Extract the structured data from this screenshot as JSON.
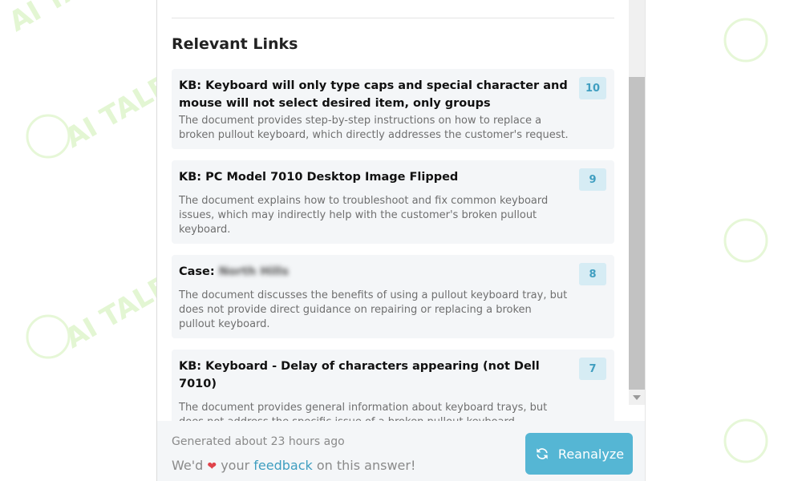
{
  "section": {
    "title": "Relevant Links"
  },
  "links": [
    {
      "title": "KB: Keyboard will only type caps and special character and mouse will not select desired item, only groups",
      "description": "The document provides step-by-step instructions on how to replace a broken pullout keyboard, which directly addresses the customer's request.",
      "score": "10"
    },
    {
      "title": "KB: PC Model 7010 Desktop Image Flipped",
      "description": "The document explains how to troubleshoot and fix common keyboard issues, which may indirectly help with the customer's broken pullout keyboard.",
      "score": "9"
    },
    {
      "title_prefix": "Case:",
      "title_redacted": "North Hills",
      "description": "The document discusses the benefits of using a pullout keyboard tray, but does not provide direct guidance on repairing or replacing a broken pullout keyboard.",
      "score": "8"
    },
    {
      "title": "KB: Keyboard - Delay of characters appearing (not Dell 7010)",
      "description": "The document provides general information about keyboard trays, but does not address the specific issue of a broken pullout keyboard.",
      "score": "7"
    }
  ],
  "footer": {
    "generated": "Generated about 23 hours ago",
    "feedback_prefix": "We'd",
    "feedback_middle": "your",
    "feedback_link": "feedback",
    "feedback_suffix": "on this answer!",
    "reanalyze_label": "Reanalyze"
  },
  "watermark": "AI TALENT SPACE",
  "icons": {
    "heart": "heart-icon",
    "reanalyze": "refresh-icon"
  },
  "colors": {
    "accent": "#55b6d4",
    "score_bg": "#d6ecf4",
    "score_text": "#3f9ec0",
    "heart": "#e0434b",
    "card_bg": "#f4f6f8"
  }
}
